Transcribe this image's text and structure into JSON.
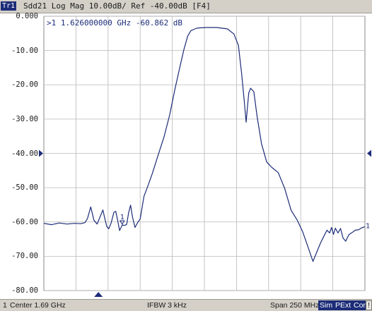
{
  "title_bar": {
    "trace_label": "Tr1",
    "text": "Sdd21 Log Mag 10.00dB/ Ref -40.00dB [F4]"
  },
  "marker": {
    "readout": ">1  1.626000000 GHz -60.862 dB",
    "label": "1"
  },
  "status": {
    "channel": "1",
    "center": "Center 1.69 GHz",
    "ifbw": "IFBW 3 kHz",
    "span": "Span 250 MHz",
    "badges": [
      "Sim",
      "PExt",
      "Cor",
      "!"
    ]
  },
  "colors": {
    "trace": "#1c2c78",
    "grid": "#b8b8b8",
    "arrow": "#1c2c78"
  },
  "chart_data": {
    "type": "line",
    "title": "Sdd21 Log Mag 10.00dB/ Ref -40.00dB [F4]",
    "xlabel": "",
    "ylabel": "",
    "xlim": [
      1.565,
      1.815
    ],
    "xunit": "GHz",
    "ylim": [
      -80,
      0
    ],
    "yticks": [
      0,
      -10,
      -20,
      -30,
      -40,
      -50,
      -60,
      -70,
      -80
    ],
    "ytick_labels": [
      "0.000",
      "-10.00",
      "-20.00",
      "-30.00",
      "-40.00",
      "-50.00",
      "-60.00",
      "-70.00",
      "-80.00"
    ],
    "x_divisions": 10,
    "grid": true,
    "series": [
      {
        "x": [
          1.565,
          1.571,
          1.577,
          1.583,
          1.589,
          1.5935,
          1.597,
          1.599,
          1.6015,
          1.604,
          1.6065,
          1.609,
          1.611,
          1.6125,
          1.614,
          1.6155,
          1.6175,
          1.6195,
          1.621,
          1.6225,
          1.624,
          1.626,
          1.628,
          1.6295,
          1.631,
          1.6325,
          1.634,
          1.636,
          1.638,
          1.64,
          1.643,
          1.646,
          1.6495,
          1.654,
          1.6585,
          1.663,
          1.667,
          1.6705,
          1.674,
          1.677,
          1.6795,
          1.682,
          1.684,
          1.6865,
          1.6915,
          1.6995,
          1.708,
          1.713,
          1.7165,
          1.719,
          1.721,
          1.7225,
          1.7245,
          1.726,
          1.7285,
          1.731,
          1.7345,
          1.7385,
          1.7425,
          1.7475,
          1.7525,
          1.7575,
          1.762,
          1.7665,
          1.7705,
          1.7745,
          1.7775,
          1.7805,
          1.7835,
          1.7855,
          1.7875,
          1.789,
          1.7905,
          1.792,
          1.794,
          1.796,
          1.798,
          1.8,
          1.8025,
          1.805,
          1.8075,
          1.81,
          1.8125,
          1.815
        ],
        "y": [
          -60.4,
          -60.8,
          -60.3,
          -60.6,
          -60.4,
          -60.5,
          -60.2,
          -59.0,
          -55.6,
          -59.5,
          -60.6,
          -58.3,
          -56.5,
          -59.1,
          -61.3,
          -62.0,
          -60.2,
          -57.2,
          -56.9,
          -59.6,
          -62.5,
          -60.9,
          -61.0,
          -60.7,
          -57.3,
          -55.1,
          -58.5,
          -61.6,
          -60.2,
          -59.1,
          -52.5,
          -49.5,
          -45.8,
          -40.5,
          -35.3,
          -28.7,
          -21.4,
          -15.5,
          -9.8,
          -5.8,
          -4.2,
          -3.8,
          -3.5,
          -3.4,
          -3.3,
          -3.3,
          -3.7,
          -5.2,
          -8.5,
          -16.8,
          -24.6,
          -30.9,
          -22.4,
          -21.0,
          -22.0,
          -29.2,
          -37.2,
          -42.5,
          -44.1,
          -45.6,
          -50.2,
          -56.6,
          -59.3,
          -62.8,
          -67.1,
          -71.5,
          -68.8,
          -66.1,
          -63.8,
          -62.4,
          -63.2,
          -61.6,
          -63.6,
          -61.8,
          -63.2,
          -61.9,
          -64.7,
          -65.6,
          -63.7,
          -63.1,
          -62.4,
          -62.3,
          -61.7,
          -61.4
        ]
      }
    ],
    "marker": {
      "x": 1.626,
      "y": -60.862,
      "label": "1"
    }
  }
}
